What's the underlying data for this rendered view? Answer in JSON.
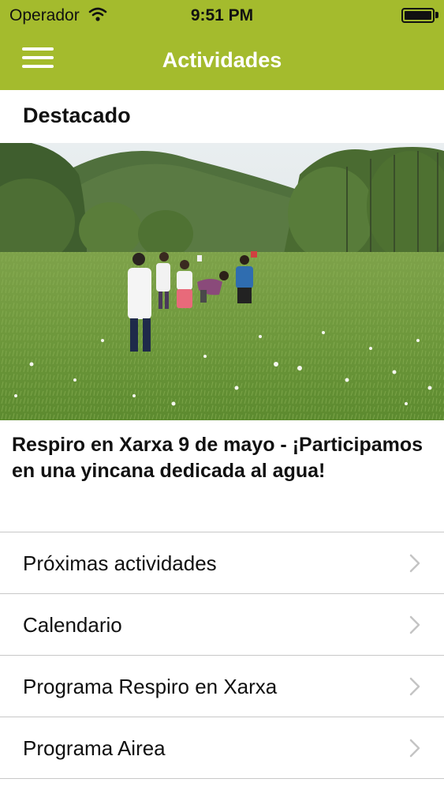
{
  "status_bar": {
    "carrier": "Operador",
    "time": "9:51 PM",
    "battery_level": 1.0
  },
  "nav": {
    "title": "Actividades",
    "menu_icon": "hamburger-menu-icon"
  },
  "section": {
    "title": "Destacado"
  },
  "featured": {
    "title": "Respiro en Xarxa 9 de mayo - ¡Participamos en una yincana dedicada al agua!"
  },
  "menu": {
    "items": [
      {
        "label": "Próximas actividades",
        "icon": "chevron-right-icon"
      },
      {
        "label": "Calendario",
        "icon": "chevron-right-icon"
      },
      {
        "label": "Programa Respiro en Xarxa",
        "icon": "chevron-right-icon"
      },
      {
        "label": "Programa Airea",
        "icon": "chevron-right-icon"
      }
    ]
  },
  "colors": {
    "brand": "#a4bb2d",
    "separator": "#c8c8c8",
    "chevron": "#c4c4c4"
  }
}
